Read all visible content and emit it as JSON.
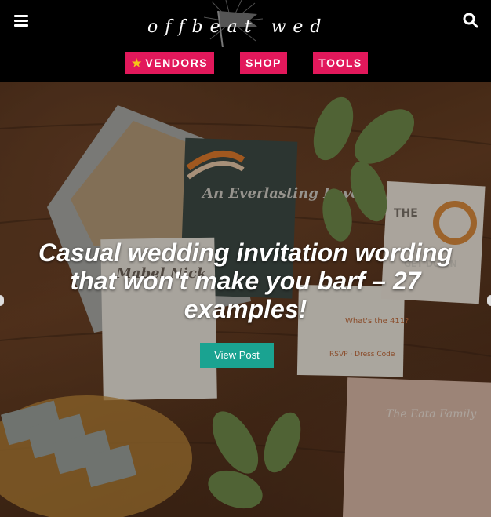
{
  "header": {
    "logo_text": "offbeat wed",
    "menu_icon": "hamburger-menu-icon",
    "search_icon": "search-icon",
    "nav": [
      {
        "label": "VENDORS",
        "icon": "star-icon"
      },
      {
        "label": "SHOP"
      },
      {
        "label": "TOOLS"
      }
    ]
  },
  "hero": {
    "title": "Casual wedding invitation wording that won't make you barf – 27 examples!",
    "button_label": "View Post",
    "card_texts": {
      "center_card": "An Everlasting Love",
      "names_card": "Mabel Nick",
      "rsvp_card": "What's the 411?",
      "rsvp_footer": "RSVP · Dress Code",
      "right_card_a": "THE",
      "right_card_b": "GET DOWN",
      "right_bottom": "The Eata Family"
    }
  },
  "colors": {
    "accent_pink": "#e2185b",
    "accent_teal": "#1aa391",
    "star_yellow": "#f5c518"
  }
}
